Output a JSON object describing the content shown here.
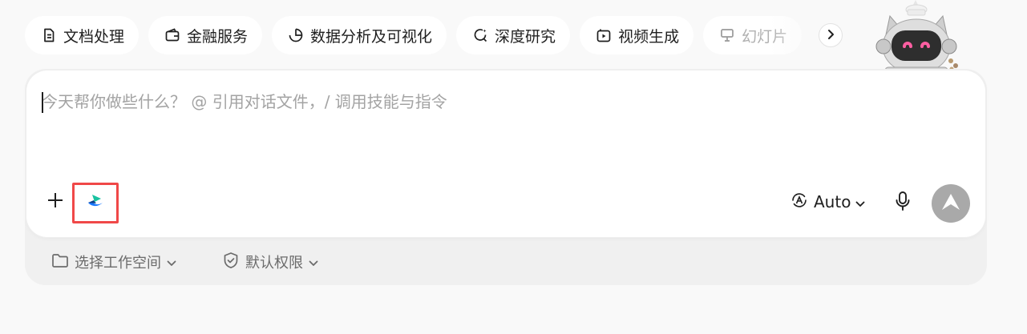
{
  "chips": [
    {
      "label": "文档处理",
      "icon": "document-icon"
    },
    {
      "label": "金融服务",
      "icon": "wallet-icon"
    },
    {
      "label": "数据分析及可视化",
      "icon": "pie-chart-icon"
    },
    {
      "label": "深度研究",
      "icon": "research-icon"
    },
    {
      "label": "视频生成",
      "icon": "video-icon"
    },
    {
      "label": "幻灯片",
      "icon": "presentation-icon"
    }
  ],
  "composer": {
    "placeholder": "今天帮你做些什么？ @ 引用对话文件，/ 调用技能与指令",
    "value": ""
  },
  "toolbar": {
    "model_label": "Auto",
    "accent_color": "#1677ff",
    "highlight_color": "#f04848",
    "send_color": "#a9a9a9"
  },
  "footer": {
    "workspace_label": "选择工作空间",
    "permission_label": "默认权限"
  }
}
